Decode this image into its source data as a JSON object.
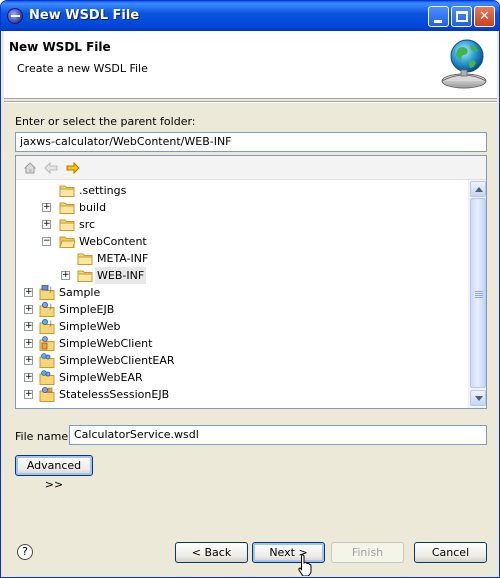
{
  "window": {
    "title": "New WSDL File"
  },
  "banner": {
    "title": "New WSDL File",
    "description": "Create a new WSDL File"
  },
  "parent_folder": {
    "label": "Enter or select the parent folder:",
    "value": "jaxws-calculator/WebContent/WEB-INF"
  },
  "tree": {
    "items": [
      {
        "label": ".settings",
        "type": "folder",
        "expandable": false
      },
      {
        "label": "build",
        "type": "folder",
        "expandable": true,
        "expanded": false
      },
      {
        "label": "src",
        "type": "folder",
        "expandable": true,
        "expanded": false
      },
      {
        "label": "WebContent",
        "type": "folder-open",
        "expandable": true,
        "expanded": true
      },
      {
        "label": "META-INF",
        "type": "folder",
        "expandable": false
      },
      {
        "label": "WEB-INF",
        "type": "folder",
        "expandable": true,
        "expanded": false,
        "selected": true
      },
      {
        "label": "Sample",
        "type": "project",
        "expandable": true,
        "expanded": false
      },
      {
        "label": "SimpleEJB",
        "type": "project",
        "expandable": true,
        "expanded": false
      },
      {
        "label": "SimpleWeb",
        "type": "project",
        "expandable": true,
        "expanded": false
      },
      {
        "label": "SimpleWebClient",
        "type": "project",
        "expandable": true,
        "expanded": false
      },
      {
        "label": "SimpleWebClientEAR",
        "type": "project",
        "expandable": true,
        "expanded": false
      },
      {
        "label": "SimpleWebEAR",
        "type": "project",
        "expandable": true,
        "expanded": false
      },
      {
        "label": "StatelessSessionEJB",
        "type": "project",
        "expandable": true,
        "expanded": false
      }
    ]
  },
  "file_name": {
    "label": "File name:",
    "value": "CalculatorService.wsdl"
  },
  "buttons": {
    "advanced": "Advanced >>",
    "back": "< Back",
    "next": "Next >",
    "finish": "Finish",
    "cancel": "Cancel"
  },
  "icons": {
    "help": "?",
    "home": "home-icon",
    "back": "back-arrow-icon",
    "forward": "forward-arrow-icon"
  },
  "colors": {
    "titlebar": "#0054e3",
    "window_bg": "#ece9d8",
    "selection": "#e8e8e8",
    "button_border": "#003c74"
  }
}
